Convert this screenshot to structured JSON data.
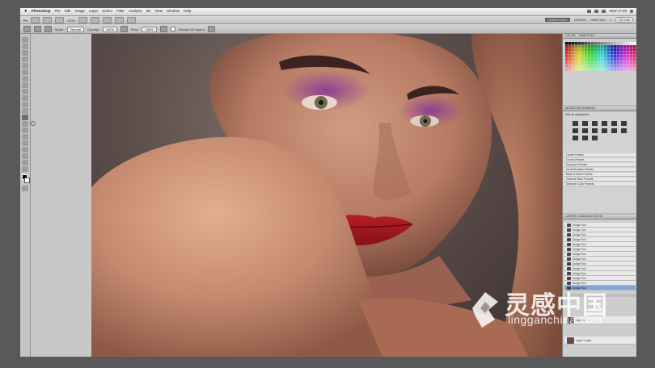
{
  "menubar": {
    "app_name": "Photoshop",
    "items": [
      "File",
      "Edit",
      "Image",
      "Layer",
      "Select",
      "Filter",
      "Analysis",
      "3D",
      "View",
      "Window",
      "Help"
    ],
    "clock": "Wed 17:49"
  },
  "appbar": {
    "zoom": "100%",
    "workspaces": [
      "ESSENTIALS",
      "DESIGN",
      "PAINTING"
    ],
    "active_workspace": "ESSENTIALS",
    "more": "»",
    "cs_live": "CS Live"
  },
  "options": {
    "mode_label": "Mode:",
    "mode_value": "Normal",
    "opacity_label": "Opacity:",
    "opacity_value": "100%",
    "flow_label": "Flow:",
    "flow_value": "100%",
    "sample_label": "Sample All Layers"
  },
  "panels": {
    "color_tabs": [
      "COLOR",
      "SWATCHES"
    ],
    "adjust_tabs": [
      "ADJUSTMENTS",
      "MASKS"
    ],
    "adjust_title": "Add an adjustment",
    "presets": [
      "Levels Presets",
      "Curves Presets",
      "Exposure Presets",
      "Hue/Saturation Presets",
      "Black & White Presets",
      "Channel Mixer Presets",
      "Selective Color Presets"
    ],
    "layers_tabs": [
      "LAYERS",
      "CHANNELS",
      "PATHS"
    ],
    "layers": [
      "Dodge Tool",
      "Dodge Tool",
      "Dodge Tool",
      "Dodge Tool",
      "Dodge Tool",
      "Dodge Tool",
      "Dodge Tool",
      "Dodge Tool",
      "Dodge Tool",
      "Dodge Tool",
      "Dodge Tool",
      "Dodge Tool",
      "Dodge Tool",
      "Dodge Tool"
    ],
    "selected_layer_index": 13,
    "thumb_layers": [
      "Layer 1",
      "Layer 1 copy"
    ]
  },
  "watermark": {
    "cn": "灵感中国",
    "en": "lingganchina.com"
  },
  "colors": {
    "lip": "#a3161f",
    "eyeshadow": "#8f3e94",
    "skin": "#c98d72",
    "background": "#4e4140",
    "selected_layer": "#7ea6d8"
  }
}
